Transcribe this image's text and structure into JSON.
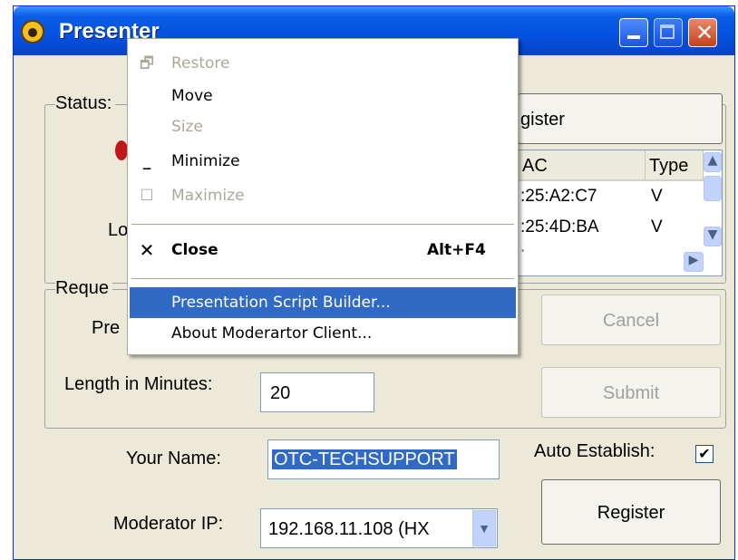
{
  "window": {
    "title": "Presenter"
  },
  "status_group": {
    "label": "Status:",
    "left_label_fragment": "Lo"
  },
  "register_top_button": {
    "label_fragment": "gister"
  },
  "client_list": {
    "columns": [
      "AC",
      "Type"
    ],
    "rows": [
      {
        "mac": ":25:A2:C7",
        "type": "V"
      },
      {
        "mac": ":25:4D:BA",
        "type": "V"
      }
    ]
  },
  "request_group": {
    "label": "Reque",
    "pref_label_fragment": "Pre"
  },
  "cancel_button": {
    "label": "Cancel"
  },
  "length": {
    "label": "Length in Minutes:",
    "value": "20"
  },
  "submit_button": {
    "label": "Submit"
  },
  "your_name": {
    "label": "Your Name:",
    "value": "OTC-TECHSUPPORT"
  },
  "auto_establish": {
    "label": "Auto Establish:",
    "checked": true,
    "check_glyph": "✔"
  },
  "moderator_ip": {
    "label": "Moderator IP:",
    "value": "192.168.11.108  (HX"
  },
  "register_button": {
    "label": "Register"
  },
  "system_menu": {
    "items": [
      {
        "label": "Restore",
        "icon": "restore-icon"
      },
      {
        "label": "Move"
      },
      {
        "label": "Size"
      },
      {
        "label": "Minimize",
        "icon": "minimize-icon"
      },
      {
        "label": "Maximize",
        "icon": "maximize-icon"
      },
      {
        "label": "Close",
        "shortcut": "Alt+F4",
        "icon": "close-icon"
      },
      {
        "label": "Presentation Script Builder..."
      },
      {
        "label": "About Moderartor Client..."
      }
    ]
  },
  "colors": {
    "titlebar": "#0551e0",
    "menu_highlight": "#316ac5",
    "face": "#ece9d8"
  }
}
